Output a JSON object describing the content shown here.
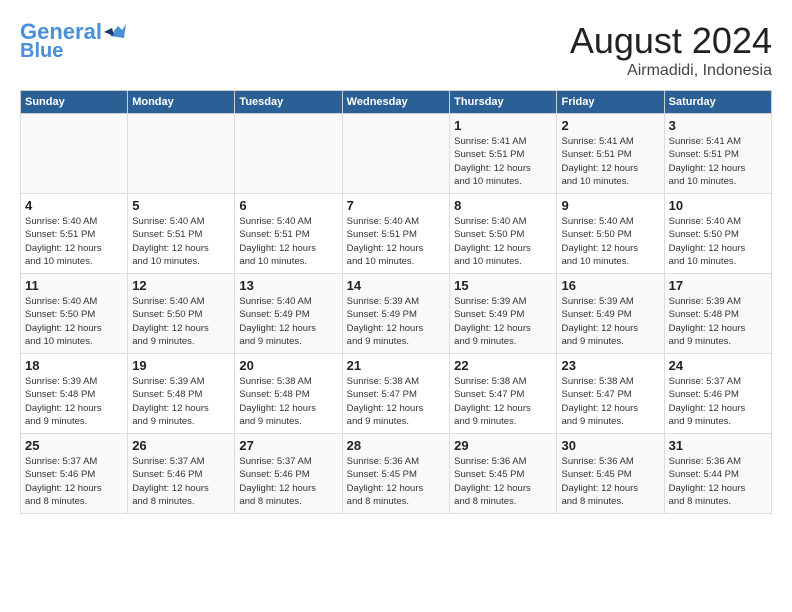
{
  "header": {
    "logo_line1": "General",
    "logo_line2": "Blue",
    "month_year": "August 2024",
    "location": "Airmadidi, Indonesia"
  },
  "weekdays": [
    "Sunday",
    "Monday",
    "Tuesday",
    "Wednesday",
    "Thursday",
    "Friday",
    "Saturday"
  ],
  "weeks": [
    [
      {
        "day": "",
        "info": ""
      },
      {
        "day": "",
        "info": ""
      },
      {
        "day": "",
        "info": ""
      },
      {
        "day": "",
        "info": ""
      },
      {
        "day": "1",
        "info": "Sunrise: 5:41 AM\nSunset: 5:51 PM\nDaylight: 12 hours\nand 10 minutes."
      },
      {
        "day": "2",
        "info": "Sunrise: 5:41 AM\nSunset: 5:51 PM\nDaylight: 12 hours\nand 10 minutes."
      },
      {
        "day": "3",
        "info": "Sunrise: 5:41 AM\nSunset: 5:51 PM\nDaylight: 12 hours\nand 10 minutes."
      }
    ],
    [
      {
        "day": "4",
        "info": "Sunrise: 5:40 AM\nSunset: 5:51 PM\nDaylight: 12 hours\nand 10 minutes."
      },
      {
        "day": "5",
        "info": "Sunrise: 5:40 AM\nSunset: 5:51 PM\nDaylight: 12 hours\nand 10 minutes."
      },
      {
        "day": "6",
        "info": "Sunrise: 5:40 AM\nSunset: 5:51 PM\nDaylight: 12 hours\nand 10 minutes."
      },
      {
        "day": "7",
        "info": "Sunrise: 5:40 AM\nSunset: 5:51 PM\nDaylight: 12 hours\nand 10 minutes."
      },
      {
        "day": "8",
        "info": "Sunrise: 5:40 AM\nSunset: 5:50 PM\nDaylight: 12 hours\nand 10 minutes."
      },
      {
        "day": "9",
        "info": "Sunrise: 5:40 AM\nSunset: 5:50 PM\nDaylight: 12 hours\nand 10 minutes."
      },
      {
        "day": "10",
        "info": "Sunrise: 5:40 AM\nSunset: 5:50 PM\nDaylight: 12 hours\nand 10 minutes."
      }
    ],
    [
      {
        "day": "11",
        "info": "Sunrise: 5:40 AM\nSunset: 5:50 PM\nDaylight: 12 hours\nand 10 minutes."
      },
      {
        "day": "12",
        "info": "Sunrise: 5:40 AM\nSunset: 5:50 PM\nDaylight: 12 hours\nand 9 minutes."
      },
      {
        "day": "13",
        "info": "Sunrise: 5:40 AM\nSunset: 5:49 PM\nDaylight: 12 hours\nand 9 minutes."
      },
      {
        "day": "14",
        "info": "Sunrise: 5:39 AM\nSunset: 5:49 PM\nDaylight: 12 hours\nand 9 minutes."
      },
      {
        "day": "15",
        "info": "Sunrise: 5:39 AM\nSunset: 5:49 PM\nDaylight: 12 hours\nand 9 minutes."
      },
      {
        "day": "16",
        "info": "Sunrise: 5:39 AM\nSunset: 5:49 PM\nDaylight: 12 hours\nand 9 minutes."
      },
      {
        "day": "17",
        "info": "Sunrise: 5:39 AM\nSunset: 5:48 PM\nDaylight: 12 hours\nand 9 minutes."
      }
    ],
    [
      {
        "day": "18",
        "info": "Sunrise: 5:39 AM\nSunset: 5:48 PM\nDaylight: 12 hours\nand 9 minutes."
      },
      {
        "day": "19",
        "info": "Sunrise: 5:39 AM\nSunset: 5:48 PM\nDaylight: 12 hours\nand 9 minutes."
      },
      {
        "day": "20",
        "info": "Sunrise: 5:38 AM\nSunset: 5:48 PM\nDaylight: 12 hours\nand 9 minutes."
      },
      {
        "day": "21",
        "info": "Sunrise: 5:38 AM\nSunset: 5:47 PM\nDaylight: 12 hours\nand 9 minutes."
      },
      {
        "day": "22",
        "info": "Sunrise: 5:38 AM\nSunset: 5:47 PM\nDaylight: 12 hours\nand 9 minutes."
      },
      {
        "day": "23",
        "info": "Sunrise: 5:38 AM\nSunset: 5:47 PM\nDaylight: 12 hours\nand 9 minutes."
      },
      {
        "day": "24",
        "info": "Sunrise: 5:37 AM\nSunset: 5:46 PM\nDaylight: 12 hours\nand 9 minutes."
      }
    ],
    [
      {
        "day": "25",
        "info": "Sunrise: 5:37 AM\nSunset: 5:46 PM\nDaylight: 12 hours\nand 8 minutes."
      },
      {
        "day": "26",
        "info": "Sunrise: 5:37 AM\nSunset: 5:46 PM\nDaylight: 12 hours\nand 8 minutes."
      },
      {
        "day": "27",
        "info": "Sunrise: 5:37 AM\nSunset: 5:46 PM\nDaylight: 12 hours\nand 8 minutes."
      },
      {
        "day": "28",
        "info": "Sunrise: 5:36 AM\nSunset: 5:45 PM\nDaylight: 12 hours\nand 8 minutes."
      },
      {
        "day": "29",
        "info": "Sunrise: 5:36 AM\nSunset: 5:45 PM\nDaylight: 12 hours\nand 8 minutes."
      },
      {
        "day": "30",
        "info": "Sunrise: 5:36 AM\nSunset: 5:45 PM\nDaylight: 12 hours\nand 8 minutes."
      },
      {
        "day": "31",
        "info": "Sunrise: 5:36 AM\nSunset: 5:44 PM\nDaylight: 12 hours\nand 8 minutes."
      }
    ]
  ]
}
